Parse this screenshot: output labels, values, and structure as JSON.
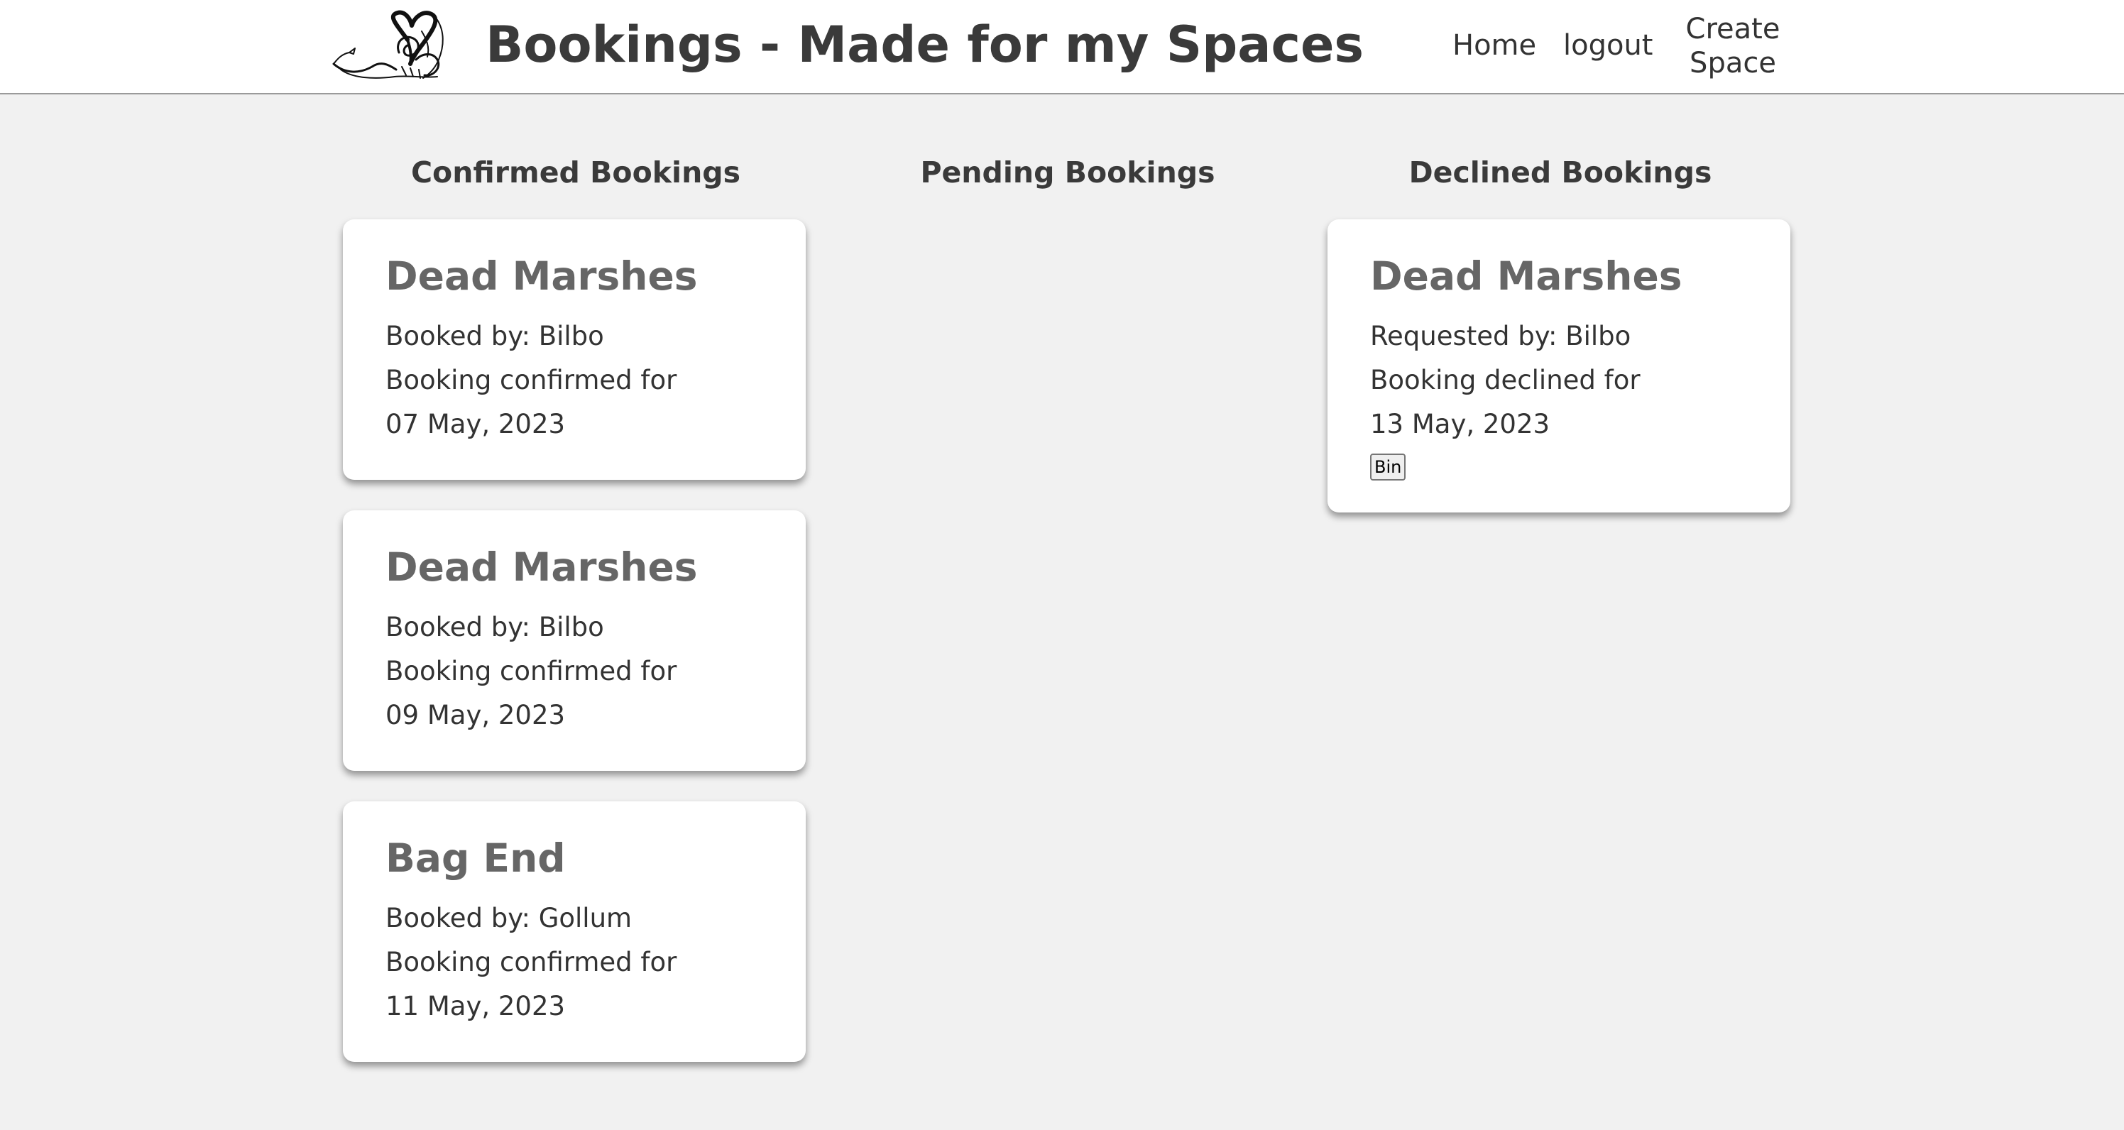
{
  "header": {
    "title": "Bookings - Made for my Spaces",
    "logo_icon": "heart-dragon-logo-icon",
    "nav": {
      "home": "Home",
      "logout": "logout",
      "create_space_line1": "Create",
      "create_space_line2": "Space"
    }
  },
  "columns": {
    "confirmed": {
      "heading": "Confirmed Bookings",
      "cards": [
        {
          "space": "Dead Marshes",
          "person_line": "Booked by: Bilbo",
          "status_line": "Booking confirmed for",
          "date": "07 May, 2023"
        },
        {
          "space": "Dead Marshes",
          "person_line": "Booked by: Bilbo",
          "status_line": "Booking confirmed for",
          "date": "09 May, 2023"
        },
        {
          "space": "Bag End",
          "person_line": "Booked by: Gollum",
          "status_line": "Booking confirmed for",
          "date": "11 May, 2023"
        }
      ]
    },
    "pending": {
      "heading": "Pending Bookings",
      "cards": []
    },
    "declined": {
      "heading": "Declined Bookings",
      "cards": [
        {
          "space": "Dead Marshes",
          "person_line": "Requested by: Bilbo",
          "status_line": "Booking declined for",
          "date": "13 May, 2023",
          "action_label": "Bin"
        }
      ]
    }
  }
}
